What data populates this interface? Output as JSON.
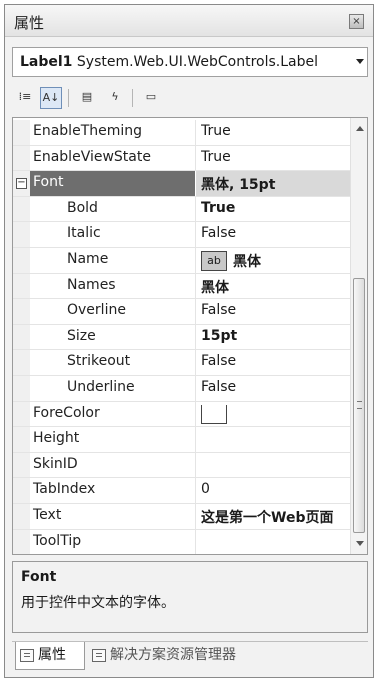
{
  "window": {
    "title": "属性",
    "close_glyph": "×"
  },
  "selector": {
    "object_name": "Label1",
    "object_type": "System.Web.UI.WebControls.Label"
  },
  "toolbar": {
    "buttons": [
      {
        "name": "categorized-icon",
        "glyph": "⁞≡"
      },
      {
        "name": "alphabetical-icon",
        "glyph": "A↓"
      },
      {
        "name": "properties-icon",
        "glyph": "▤"
      },
      {
        "name": "events-icon",
        "glyph": "ϟ"
      },
      {
        "name": "property-pages-icon",
        "glyph": "▭"
      }
    ]
  },
  "properties": [
    {
      "name": "EnableTheming",
      "value": "True"
    },
    {
      "name": "EnableViewState",
      "value": "True"
    },
    {
      "name": "Font",
      "value": "黑体, 15pt",
      "expander": "−"
    },
    {
      "name": "Bold",
      "value": "True"
    },
    {
      "name": "Italic",
      "value": "False"
    },
    {
      "name": "Name",
      "value": "黑体",
      "swatch": "ab"
    },
    {
      "name": "Names",
      "value": "黑体"
    },
    {
      "name": "Overline",
      "value": "False"
    },
    {
      "name": "Size",
      "value": "15pt"
    },
    {
      "name": "Strikeout",
      "value": "False"
    },
    {
      "name": "Underline",
      "value": "False"
    },
    {
      "name": "ForeColor",
      "value": ""
    },
    {
      "name": "Height",
      "value": ""
    },
    {
      "name": "SkinID",
      "value": ""
    },
    {
      "name": "TabIndex",
      "value": "0"
    },
    {
      "name": "Text",
      "value": "这是第一个Web页面"
    },
    {
      "name": "ToolTip",
      "value": ""
    }
  ],
  "description": {
    "title": "Font",
    "text": "用于控件中文本的字体。"
  },
  "tabs": {
    "properties": "属性",
    "solution_explorer": "解决方案资源管理器"
  }
}
